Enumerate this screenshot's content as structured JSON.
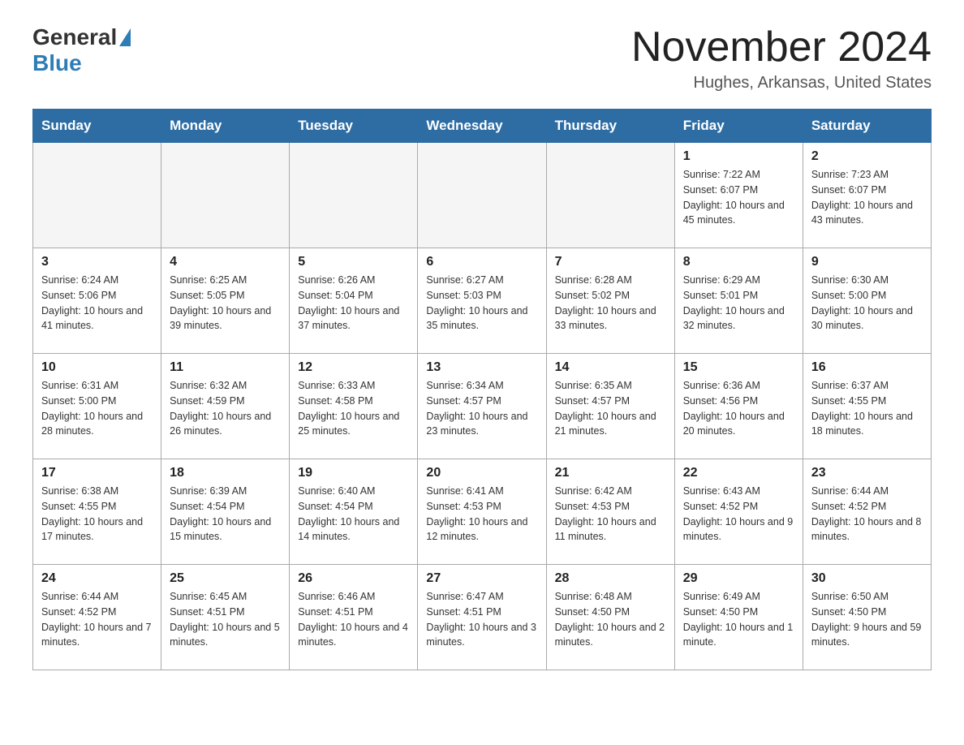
{
  "header": {
    "logo_general": "General",
    "logo_blue": "Blue",
    "title": "November 2024",
    "subtitle": "Hughes, Arkansas, United States"
  },
  "weekdays": [
    "Sunday",
    "Monday",
    "Tuesday",
    "Wednesday",
    "Thursday",
    "Friday",
    "Saturday"
  ],
  "weeks": [
    [
      {
        "day": "",
        "info": ""
      },
      {
        "day": "",
        "info": ""
      },
      {
        "day": "",
        "info": ""
      },
      {
        "day": "",
        "info": ""
      },
      {
        "day": "",
        "info": ""
      },
      {
        "day": "1",
        "info": "Sunrise: 7:22 AM\nSunset: 6:07 PM\nDaylight: 10 hours and 45 minutes."
      },
      {
        "day": "2",
        "info": "Sunrise: 7:23 AM\nSunset: 6:07 PM\nDaylight: 10 hours and 43 minutes."
      }
    ],
    [
      {
        "day": "3",
        "info": "Sunrise: 6:24 AM\nSunset: 5:06 PM\nDaylight: 10 hours and 41 minutes."
      },
      {
        "day": "4",
        "info": "Sunrise: 6:25 AM\nSunset: 5:05 PM\nDaylight: 10 hours and 39 minutes."
      },
      {
        "day": "5",
        "info": "Sunrise: 6:26 AM\nSunset: 5:04 PM\nDaylight: 10 hours and 37 minutes."
      },
      {
        "day": "6",
        "info": "Sunrise: 6:27 AM\nSunset: 5:03 PM\nDaylight: 10 hours and 35 minutes."
      },
      {
        "day": "7",
        "info": "Sunrise: 6:28 AM\nSunset: 5:02 PM\nDaylight: 10 hours and 33 minutes."
      },
      {
        "day": "8",
        "info": "Sunrise: 6:29 AM\nSunset: 5:01 PM\nDaylight: 10 hours and 32 minutes."
      },
      {
        "day": "9",
        "info": "Sunrise: 6:30 AM\nSunset: 5:00 PM\nDaylight: 10 hours and 30 minutes."
      }
    ],
    [
      {
        "day": "10",
        "info": "Sunrise: 6:31 AM\nSunset: 5:00 PM\nDaylight: 10 hours and 28 minutes."
      },
      {
        "day": "11",
        "info": "Sunrise: 6:32 AM\nSunset: 4:59 PM\nDaylight: 10 hours and 26 minutes."
      },
      {
        "day": "12",
        "info": "Sunrise: 6:33 AM\nSunset: 4:58 PM\nDaylight: 10 hours and 25 minutes."
      },
      {
        "day": "13",
        "info": "Sunrise: 6:34 AM\nSunset: 4:57 PM\nDaylight: 10 hours and 23 minutes."
      },
      {
        "day": "14",
        "info": "Sunrise: 6:35 AM\nSunset: 4:57 PM\nDaylight: 10 hours and 21 minutes."
      },
      {
        "day": "15",
        "info": "Sunrise: 6:36 AM\nSunset: 4:56 PM\nDaylight: 10 hours and 20 minutes."
      },
      {
        "day": "16",
        "info": "Sunrise: 6:37 AM\nSunset: 4:55 PM\nDaylight: 10 hours and 18 minutes."
      }
    ],
    [
      {
        "day": "17",
        "info": "Sunrise: 6:38 AM\nSunset: 4:55 PM\nDaylight: 10 hours and 17 minutes."
      },
      {
        "day": "18",
        "info": "Sunrise: 6:39 AM\nSunset: 4:54 PM\nDaylight: 10 hours and 15 minutes."
      },
      {
        "day": "19",
        "info": "Sunrise: 6:40 AM\nSunset: 4:54 PM\nDaylight: 10 hours and 14 minutes."
      },
      {
        "day": "20",
        "info": "Sunrise: 6:41 AM\nSunset: 4:53 PM\nDaylight: 10 hours and 12 minutes."
      },
      {
        "day": "21",
        "info": "Sunrise: 6:42 AM\nSunset: 4:53 PM\nDaylight: 10 hours and 11 minutes."
      },
      {
        "day": "22",
        "info": "Sunrise: 6:43 AM\nSunset: 4:52 PM\nDaylight: 10 hours and 9 minutes."
      },
      {
        "day": "23",
        "info": "Sunrise: 6:44 AM\nSunset: 4:52 PM\nDaylight: 10 hours and 8 minutes."
      }
    ],
    [
      {
        "day": "24",
        "info": "Sunrise: 6:44 AM\nSunset: 4:52 PM\nDaylight: 10 hours and 7 minutes."
      },
      {
        "day": "25",
        "info": "Sunrise: 6:45 AM\nSunset: 4:51 PM\nDaylight: 10 hours and 5 minutes."
      },
      {
        "day": "26",
        "info": "Sunrise: 6:46 AM\nSunset: 4:51 PM\nDaylight: 10 hours and 4 minutes."
      },
      {
        "day": "27",
        "info": "Sunrise: 6:47 AM\nSunset: 4:51 PM\nDaylight: 10 hours and 3 minutes."
      },
      {
        "day": "28",
        "info": "Sunrise: 6:48 AM\nSunset: 4:50 PM\nDaylight: 10 hours and 2 minutes."
      },
      {
        "day": "29",
        "info": "Sunrise: 6:49 AM\nSunset: 4:50 PM\nDaylight: 10 hours and 1 minute."
      },
      {
        "day": "30",
        "info": "Sunrise: 6:50 AM\nSunset: 4:50 PM\nDaylight: 9 hours and 59 minutes."
      }
    ]
  ]
}
